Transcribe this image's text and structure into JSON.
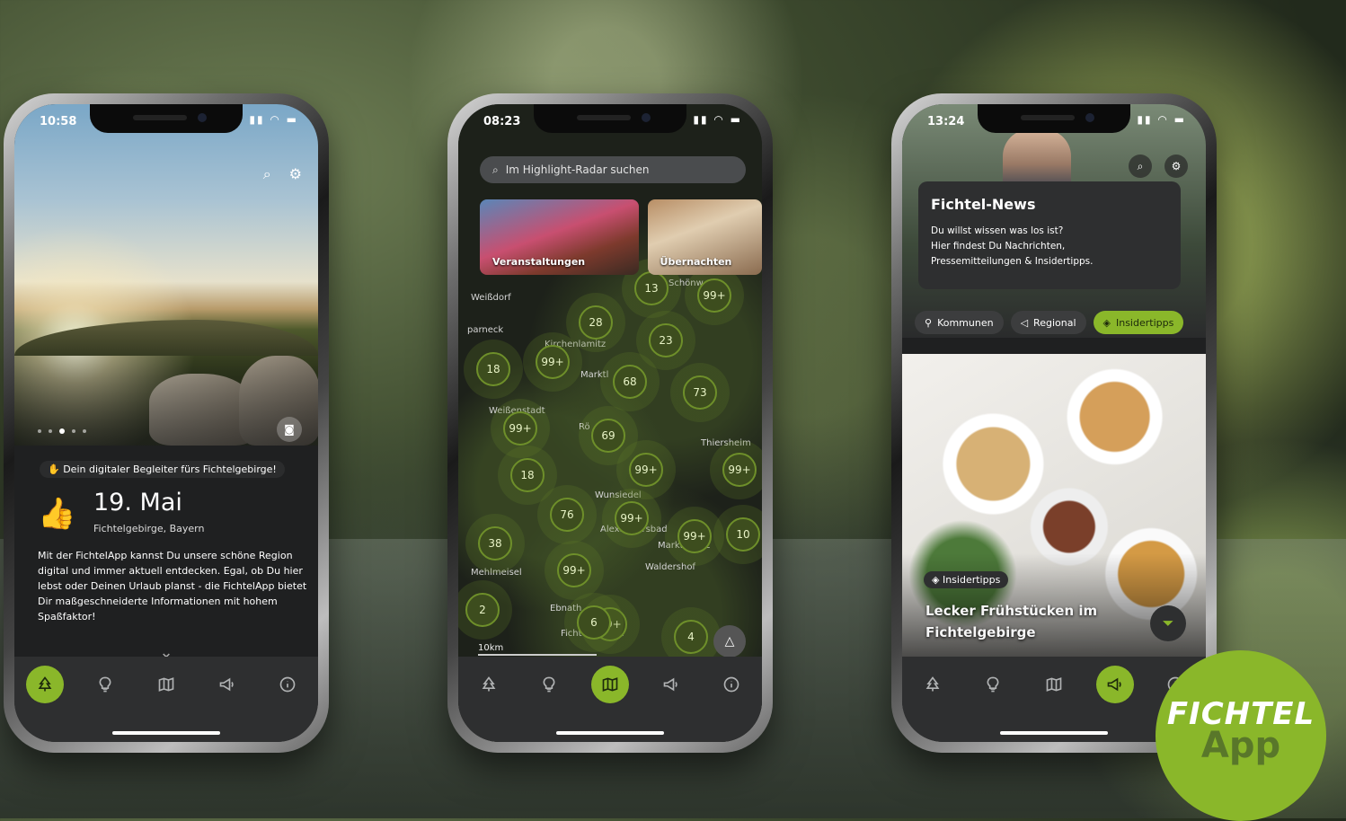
{
  "phone1": {
    "status_time": "10:58",
    "badge": "Dein digitaler Begleiter fürs Fichtelgebirge!",
    "date": "19. Mai",
    "place": "Fichtelgebirge, Bayern",
    "description": "Mit der FichtelApp kannst Du unsere schöne Region digital und immer aktuell entdecken. Egal, ob Du hier lebst oder Deinen Urlaub planst - die FichtelApp bietet Dir maßgeschneiderte Informationen mit hohem Spaßfaktor!",
    "icons": [
      "search-icon",
      "gear-icon",
      "camera-icon",
      "thumbs-up-icon",
      "chevron-down-icon"
    ]
  },
  "phone2": {
    "status_time": "08:23",
    "search_placeholder": "Im Highlight-Radar suchen",
    "cards": [
      "Veranstaltungen",
      "Übernachten"
    ],
    "clusters": [
      "13",
      "99+",
      "28",
      "23",
      "99+",
      "18",
      "68",
      "73",
      "99+",
      "69",
      "99+",
      "99+",
      "18",
      "99+",
      "76",
      "99+",
      "99+",
      "10",
      "38",
      "99+",
      "2",
      "6",
      "4"
    ],
    "towns": [
      "Weißdorf",
      "parneck",
      "Kirchenlamitz",
      "Marktl",
      "Weißenstadt",
      "Rö",
      "Thiersheim",
      "Wunsiedel",
      "Alexandersbad",
      "Markt...witz",
      "Mehlmeisel",
      "Waldershof",
      "Ebnath",
      "Fichtelgebirge",
      "Schönw"
    ],
    "scale": "10km"
  },
  "phone3": {
    "status_time": "13:24",
    "news_title": "Fichtel-News",
    "news_text_1": "Du willst wissen was los ist?",
    "news_text_2": "Hier findest Du Nachrichten,",
    "news_text_3": "Pressemitteilungen & Insidertipps.",
    "chips": [
      "Kommunen",
      "Regional",
      "Insidertipps"
    ],
    "food_badge": "Insidertipps",
    "food_title": "Lecker Frühstücken im Fichtelgebirge"
  },
  "tabs": [
    "tree-icon",
    "lightbulb-icon",
    "map-icon",
    "megaphone-icon",
    "info-icon"
  ],
  "logo": {
    "line1": "FICHTEL",
    "line2": "App"
  },
  "colors": {
    "accent": "#8ab72a",
    "panel": "#2e2f30"
  }
}
